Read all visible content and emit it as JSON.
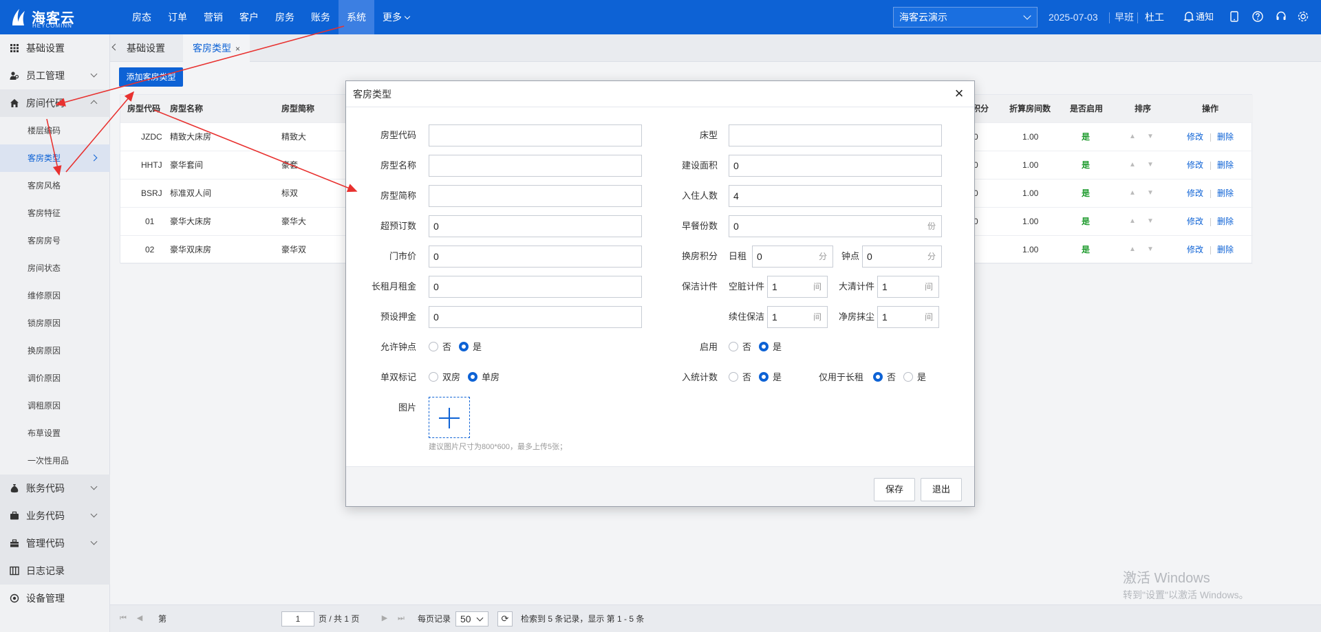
{
  "app": {
    "brand": "海客云",
    "brand_sub": "HEYCOMINN"
  },
  "nav": [
    "房态",
    "订单",
    "营销",
    "客户",
    "房务",
    "账务",
    "系统",
    "更多"
  ],
  "header": {
    "hotel": "海客云演示",
    "date": "2025-07-03",
    "shift": "早班",
    "user": "杜工",
    "notice": "通知"
  },
  "sidebar": {
    "groups": [
      {
        "label": "基础设置",
        "icon": "grid-icon"
      },
      {
        "label": "员工管理",
        "icon": "users-icon"
      },
      {
        "label": "房间代码",
        "icon": "home-icon"
      }
    ],
    "sub_items": [
      "楼层编码",
      "客房类型",
      "客房风格",
      "客房特征",
      "客房房号",
      "房间状态",
      "维修原因",
      "锁房原因",
      "换房原因",
      "调价原因",
      "调租原因",
      "布草设置",
      "一次性用品"
    ],
    "groups_after": [
      {
        "label": "账务代码",
        "icon": "money-bag-icon"
      },
      {
        "label": "业务代码",
        "icon": "briefcase-icon"
      },
      {
        "label": "管理代码",
        "icon": "toolbox-icon"
      },
      {
        "label": "日志记录",
        "icon": "log-icon"
      },
      {
        "label": "设备管理",
        "icon": "device-icon"
      }
    ]
  },
  "tabs": [
    {
      "label": "基础设置"
    },
    {
      "label": "客房类型",
      "close": "×"
    }
  ],
  "toolbar": {
    "add_label": "添加客房类型"
  },
  "table": {
    "headers": {
      "code": "房型代码",
      "name": "房型名称",
      "short": "房型简称",
      "points": "积分",
      "equiv": "折算房间数",
      "enabled": "是否启用",
      "sort": "排序",
      "ops": "操作"
    },
    "rows": [
      {
        "code": "JZDC",
        "name": "精致大床房",
        "short": "精致大",
        "points": "0",
        "equiv": "1.00",
        "enabled": "是"
      },
      {
        "code": "HHTJ",
        "name": "豪华套间",
        "short": "豪套",
        "points": "0",
        "equiv": "1.00",
        "enabled": "是"
      },
      {
        "code": "BSRJ",
        "name": "标准双人间",
        "short": "标双",
        "points": "0",
        "equiv": "1.00",
        "enabled": "是"
      },
      {
        "code": "01",
        "name": "豪华大床房",
        "short": "豪华大",
        "points": "0",
        "equiv": "1.00",
        "enabled": "是"
      },
      {
        "code": "02",
        "name": "豪华双床房",
        "short": "豪华双",
        "points": "",
        "equiv": "1.00",
        "enabled": "是"
      }
    ],
    "edit": "修改",
    "delete": "删除"
  },
  "pager": {
    "page_prefix": "第",
    "page": "1",
    "page_suffix": "页 / 共 1 页",
    "per_page_label": "每页记录",
    "per_page": "50",
    "summary": "检索到 5 条记录，显示 第 1 - 5 条"
  },
  "watermark": {
    "line1": "激活 Windows",
    "line2": "转到\"设置\"以激活 Windows。"
  },
  "modal": {
    "title": "客房类型",
    "close": "×",
    "fields": {
      "type_code": {
        "label": "房型代码",
        "value": ""
      },
      "type_name": {
        "label": "房型名称",
        "value": ""
      },
      "type_short": {
        "label": "房型简称",
        "value": ""
      },
      "overbook": {
        "label": "超预订数",
        "value": "0"
      },
      "rack_rate": {
        "label": "门市价",
        "value": "0"
      },
      "long_rent": {
        "label": "长租月租金",
        "value": "0"
      },
      "deposit": {
        "label": "预设押金",
        "value": "0"
      },
      "bed_type": {
        "label": "床型",
        "value": ""
      },
      "area": {
        "label": "建设面积",
        "value": "0"
      },
      "occupancy": {
        "label": "入住人数",
        "value": "4"
      },
      "breakfast": {
        "label": "早餐份数",
        "value": "0",
        "unit": "份"
      },
      "change_points": {
        "label": "换房积分",
        "day_label": "日租",
        "day_value": "0",
        "hour_label": "钟点",
        "hour_value": "0",
        "unit": "分"
      },
      "cleaning": {
        "label": "保洁计件",
        "dirty_label": "空脏计件",
        "dirty_value": "1",
        "deep_label": "大清计件",
        "deep_value": "1",
        "stay_label": "续住保洁",
        "stay_value": "1",
        "dust_label": "净房抹尘",
        "dust_value": "1",
        "unit": "间"
      }
    },
    "allow_hourly": {
      "label": "允许钟点",
      "options": [
        "否",
        "是"
      ],
      "selected": "是"
    },
    "single_double": {
      "label": "单双标记",
      "options": [
        "双房",
        "单房"
      ],
      "selected": "单房"
    },
    "enabled": {
      "label": "启用",
      "options": [
        "否",
        "是"
      ],
      "selected": "是"
    },
    "count_stats": {
      "label": "入统计数",
      "options": [
        "否",
        "是"
      ],
      "selected": "是"
    },
    "long_only": {
      "label": "仅用于长租",
      "options": [
        "否",
        "是"
      ],
      "selected": "否"
    },
    "image": {
      "label": "图片",
      "hint": "建议图片尺寸为800*600，最多上传5张；"
    },
    "save": "保存",
    "exit": "退出"
  },
  "colors": {
    "primary": "#0d62d5",
    "header_bg": "#0d62d5",
    "annotation": "#e8312f",
    "enabled_text": "#1f9b2e"
  }
}
